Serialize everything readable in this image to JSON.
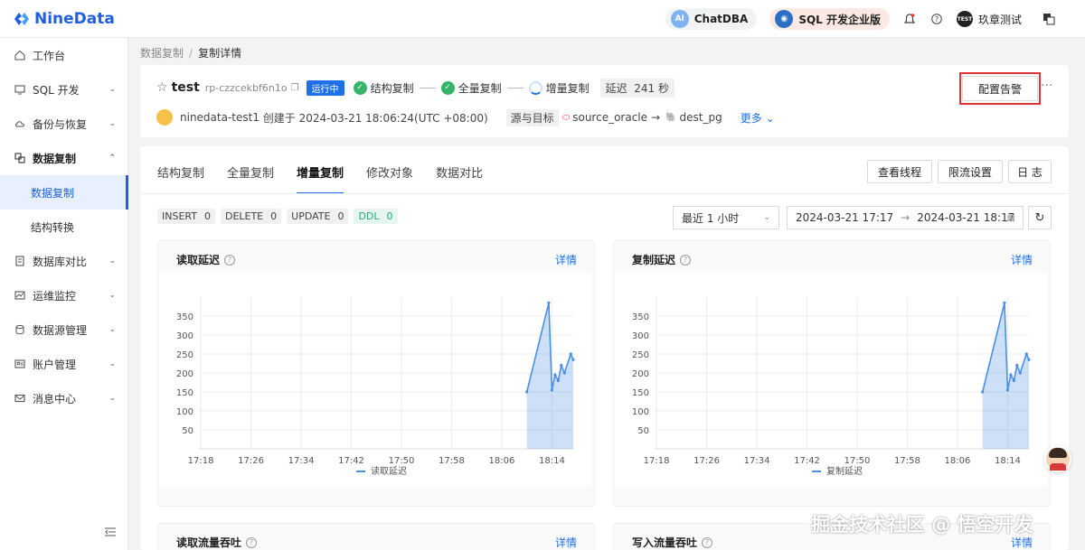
{
  "app": {
    "logo_text": "NineData",
    "chatdba_label": "ChatDBA",
    "chatdba_badge": "AI",
    "sql_label": "SQL 开发企业版",
    "user_avatar_text": "TEST",
    "user_name": "玖章测试"
  },
  "sidebar": {
    "items": [
      {
        "label": "工作台",
        "icon": "home-icon"
      },
      {
        "label": "SQL 开发",
        "icon": "monitor-icon"
      },
      {
        "label": "备份与恢复",
        "icon": "cloud-icon"
      },
      {
        "label": "数据复制",
        "icon": "replicate-icon"
      },
      {
        "label": "数据复制",
        "icon": ""
      },
      {
        "label": "结构转换",
        "icon": ""
      },
      {
        "label": "数据库对比",
        "icon": "compare-icon"
      },
      {
        "label": "运维监控",
        "icon": "monitor-icon"
      },
      {
        "label": "数据源管理",
        "icon": "database-icon"
      },
      {
        "label": "账户管理",
        "icon": "account-icon"
      },
      {
        "label": "消息中心",
        "icon": "mail-icon"
      }
    ]
  },
  "breadcrumb": {
    "parent": "数据复制",
    "sep": "/",
    "current": "复制详情"
  },
  "task": {
    "name": "test",
    "id": "rp-czzcekbf6n1o",
    "status": "运行中",
    "steps": [
      "结构复制",
      "全量复制",
      "增量复制"
    ],
    "delay_label": "延迟",
    "delay_value": "241 秒",
    "creator": "ninedata-test1",
    "created_text": "创建于 2024-03-21 18:06:24(UTC +08:00)",
    "src_dst_label": "源与目标",
    "source": "source_oracle",
    "arrow": "→",
    "target": "dest_pg",
    "more": "更多",
    "alert_button": "配置告警",
    "more_dots": "···"
  },
  "tabs": [
    "结构复制",
    "全量复制",
    "增量复制",
    "修改对象",
    "数据对比"
  ],
  "actions": {
    "threads": "查看线程",
    "throttle": "限流设置",
    "log": "日 志"
  },
  "stats": [
    {
      "label": "INSERT",
      "value": "0"
    },
    {
      "label": "DELETE",
      "value": "0"
    },
    {
      "label": "UPDATE",
      "value": "0"
    },
    {
      "label": "DDL",
      "value": "0"
    }
  ],
  "filters": {
    "range_select": "最近 1 小时",
    "start": "2024-03-21 17:17",
    "to": "→",
    "end": "2024-03-21 18:17"
  },
  "panels": {
    "read_delay_title": "读取延迟",
    "copy_delay_title": "复制延迟",
    "read_flow_title": "读取流量吞吐",
    "write_flow_title": "写入流量吞吐",
    "detail": "详情",
    "help": "?"
  },
  "colors": {
    "accent": "#1f6fe8",
    "ok": "#36b36b",
    "alert_frame": "#e03434",
    "series": "#4a8fe6"
  },
  "watermark": "掘金技术社区 @ 悟空开发",
  "chart_data": [
    {
      "type": "area",
      "xlabel": "",
      "ylabel": "",
      "x_ticks": [
        "17:18",
        "17:26",
        "17:34",
        "17:42",
        "17:50",
        "17:58",
        "18:06",
        "18:14"
      ],
      "y_ticks": [
        50,
        100,
        150,
        200,
        250,
        300,
        350
      ],
      "ylim": [
        0,
        400
      ],
      "series": [
        {
          "name": "读取延迟",
          "points": [
            [
              "18:10",
              150
            ],
            [
              "18:13.5",
              385
            ],
            [
              "18:14",
              155
            ],
            [
              "18:14.5",
              195
            ],
            [
              "18:15",
              180
            ],
            [
              "18:15.5",
              220
            ],
            [
              "18:16",
              200
            ],
            [
              "18:17",
              250
            ],
            [
              "18:17.4",
              235
            ]
          ]
        }
      ]
    },
    {
      "type": "area",
      "xlabel": "",
      "ylabel": "",
      "x_ticks": [
        "17:18",
        "17:26",
        "17:34",
        "17:42",
        "17:50",
        "17:58",
        "18:06",
        "18:14"
      ],
      "y_ticks": [
        50,
        100,
        150,
        200,
        250,
        300,
        350
      ],
      "ylim": [
        0,
        400
      ],
      "series": [
        {
          "name": "复制延迟",
          "points": [
            [
              "18:10",
              150
            ],
            [
              "18:13.5",
              385
            ],
            [
              "18:14",
              155
            ],
            [
              "18:14.5",
              195
            ],
            [
              "18:15",
              180
            ],
            [
              "18:15.5",
              220
            ],
            [
              "18:16",
              200
            ],
            [
              "18:17",
              250
            ],
            [
              "18:17.4",
              235
            ]
          ]
        }
      ]
    }
  ]
}
